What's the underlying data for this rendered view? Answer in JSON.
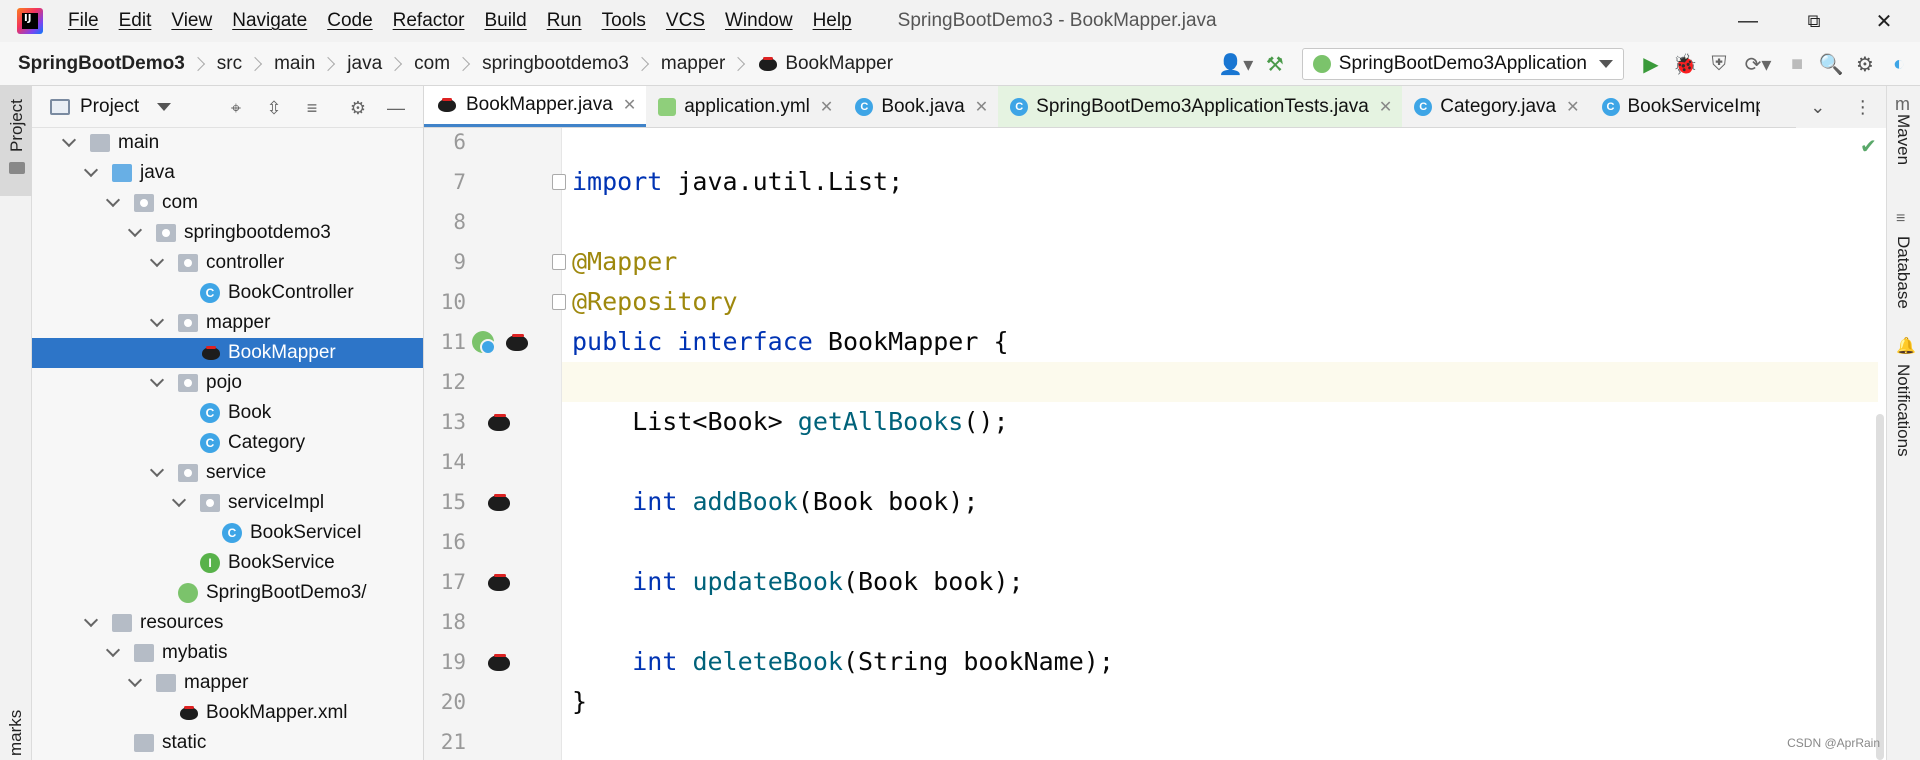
{
  "menubar": {
    "items": [
      "File",
      "Edit",
      "View",
      "Navigate",
      "Code",
      "Refactor",
      "Build",
      "Run",
      "Tools",
      "VCS",
      "Window",
      "Help"
    ],
    "window_title": "SpringBootDemo3 - BookMapper.java"
  },
  "navbar": {
    "breadcrumb": [
      "SpringBootDemo3",
      "src",
      "main",
      "java",
      "com",
      "springbootdemo3",
      "mapper",
      "BookMapper"
    ],
    "run_config": "SpringBootDemo3Application"
  },
  "left_stripe": {
    "project_label": "Project",
    "bookmarks_label": "marks"
  },
  "right_stripe": {
    "maven_label": "Maven",
    "database_label": "Database",
    "notifications_label": "Notifications"
  },
  "project_panel": {
    "title": "Project",
    "tree": [
      {
        "label": "main",
        "kind": "folder",
        "level": 0,
        "expanded": true
      },
      {
        "label": "java",
        "kind": "folder-blue",
        "level": 1,
        "expanded": true
      },
      {
        "label": "com",
        "kind": "package",
        "level": 2,
        "expanded": true
      },
      {
        "label": "springbootdemo3",
        "kind": "package",
        "level": 3,
        "expanded": true
      },
      {
        "label": "controller",
        "kind": "package",
        "level": 4,
        "expanded": true
      },
      {
        "label": "BookController",
        "kind": "class",
        "level": 5
      },
      {
        "label": "mapper",
        "kind": "package",
        "level": 4,
        "expanded": true
      },
      {
        "label": "BookMapper",
        "kind": "mybatis",
        "level": 5,
        "selected": true
      },
      {
        "label": "pojo",
        "kind": "package",
        "level": 4,
        "expanded": true
      },
      {
        "label": "Book",
        "kind": "class",
        "level": 5
      },
      {
        "label": "Category",
        "kind": "class",
        "level": 5
      },
      {
        "label": "service",
        "kind": "package",
        "level": 4,
        "expanded": true
      },
      {
        "label": "serviceImpl",
        "kind": "package",
        "level": 5,
        "expanded": true
      },
      {
        "label": "BookServiceI",
        "kind": "class",
        "level": 6
      },
      {
        "label": "BookService",
        "kind": "interface",
        "level": 5
      },
      {
        "label": "SpringBootDemo3/",
        "kind": "spring",
        "level": 4
      },
      {
        "label": "resources",
        "kind": "folder",
        "level": 1,
        "expanded": true
      },
      {
        "label": "mybatis",
        "kind": "folder",
        "level": 2,
        "expanded": true
      },
      {
        "label": "mapper",
        "kind": "folder",
        "level": 3,
        "expanded": true
      },
      {
        "label": "BookMapper.xml",
        "kind": "mybatis",
        "level": 4
      },
      {
        "label": "static",
        "kind": "folder",
        "level": 2
      }
    ]
  },
  "editor": {
    "tabs": [
      {
        "label": "BookMapper.java",
        "icon": "mybatis-icon",
        "active": true,
        "closable": true
      },
      {
        "label": "application.yml",
        "icon": "yaml-icon",
        "closable": true
      },
      {
        "label": "Book.java",
        "icon": "class-icon",
        "closable": true
      },
      {
        "label": "SpringBootDemo3ApplicationTests.java",
        "icon": "class-icon",
        "closable": true,
        "tests": true
      },
      {
        "label": "Category.java",
        "icon": "class-icon",
        "closable": true
      },
      {
        "label": "BookServiceImpl",
        "icon": "class-icon",
        "closable": false
      }
    ],
    "lines": [
      {
        "num": "6",
        "tokens": []
      },
      {
        "num": "7",
        "tokens": [
          {
            "t": "import",
            "c": "kw"
          },
          {
            "t": " java.util.List;",
            "c": ""
          }
        ]
      },
      {
        "num": "8",
        "tokens": []
      },
      {
        "num": "9",
        "tokens": [
          {
            "t": "@Mapper",
            "c": "ann"
          }
        ]
      },
      {
        "num": "10",
        "tokens": [
          {
            "t": "@Repository",
            "c": "ann"
          }
        ]
      },
      {
        "num": "11",
        "tokens": [
          {
            "t": "public",
            "c": "kw"
          },
          {
            "t": " ",
            "c": ""
          },
          {
            "t": "interface",
            "c": "kw"
          },
          {
            "t": " BookMapper {",
            "c": ""
          }
        ]
      },
      {
        "num": "12",
        "tokens": [],
        "current": true
      },
      {
        "num": "13",
        "tokens": [
          {
            "t": "    List<Book> ",
            "c": ""
          },
          {
            "t": "getAllBooks",
            "c": "fn"
          },
          {
            "t": "();",
            "c": ""
          }
        ]
      },
      {
        "num": "14",
        "tokens": []
      },
      {
        "num": "15",
        "tokens": [
          {
            "t": "    ",
            "c": ""
          },
          {
            "t": "int",
            "c": "kw"
          },
          {
            "t": " ",
            "c": ""
          },
          {
            "t": "addBook",
            "c": "fn"
          },
          {
            "t": "(Book book);",
            "c": ""
          }
        ]
      },
      {
        "num": "16",
        "tokens": []
      },
      {
        "num": "17",
        "tokens": [
          {
            "t": "    ",
            "c": ""
          },
          {
            "t": "int",
            "c": "kw"
          },
          {
            "t": " ",
            "c": ""
          },
          {
            "t": "updateBook",
            "c": "fn"
          },
          {
            "t": "(Book book);",
            "c": ""
          }
        ]
      },
      {
        "num": "18",
        "tokens": []
      },
      {
        "num": "19",
        "tokens": [
          {
            "t": "    ",
            "c": ""
          },
          {
            "t": "int",
            "c": "kw"
          },
          {
            "t": " ",
            "c": ""
          },
          {
            "t": "deleteBook",
            "c": "fn"
          },
          {
            "t": "(String bookName);",
            "c": ""
          }
        ]
      },
      {
        "num": "20",
        "tokens": [
          {
            "t": "}",
            "c": ""
          }
        ]
      },
      {
        "num": "21",
        "tokens": []
      }
    ]
  },
  "watermark": "CSDN @AprRain",
  "colors": {
    "selection": "#2d75c8",
    "keyword": "#0033b3",
    "annotation": "#9e880d",
    "method": "#00627a",
    "current_line": "#fcfaed"
  }
}
